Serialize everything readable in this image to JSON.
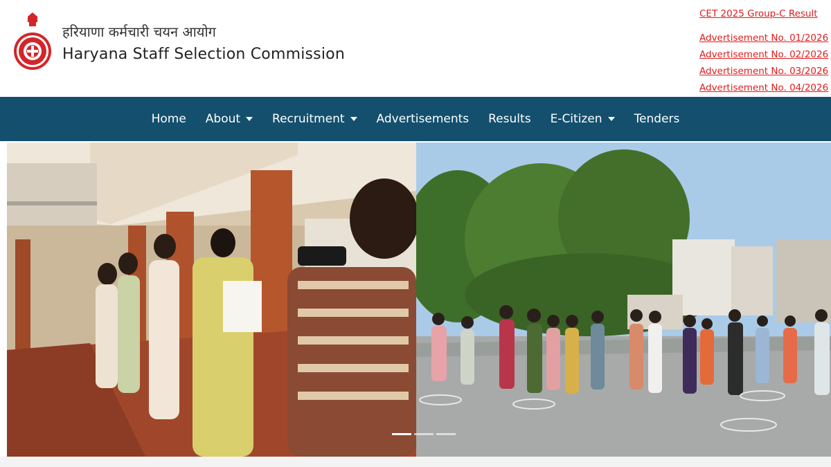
{
  "header": {
    "title_hindi": "हरियाणा कर्मचारी चयन आयोग",
    "title_english": "Haryana Staff Selection Commission",
    "emblem_icon": "state-emblem-icon"
  },
  "top_links": [
    "CET 2025 Group-C Result",
    "Advertisement No. 01/2026",
    "Advertisement No. 02/2026",
    "Advertisement No. 03/2026",
    "Advertisement No. 04/2026"
  ],
  "nav": {
    "items": [
      {
        "label": "Home",
        "dropdown": false
      },
      {
        "label": "About",
        "dropdown": true
      },
      {
        "label": "Recruitment",
        "dropdown": true
      },
      {
        "label": "Advertisements",
        "dropdown": false
      },
      {
        "label": "Results",
        "dropdown": false
      },
      {
        "label": "E-Citizen",
        "dropdown": true
      },
      {
        "label": "Tenders",
        "dropdown": false
      }
    ]
  },
  "banner": {
    "slides_count": 3,
    "active_slide": 1
  },
  "colors": {
    "nav_bg": "#14506e",
    "link_red": "#e01b1b",
    "emblem_red": "#d2262a"
  }
}
